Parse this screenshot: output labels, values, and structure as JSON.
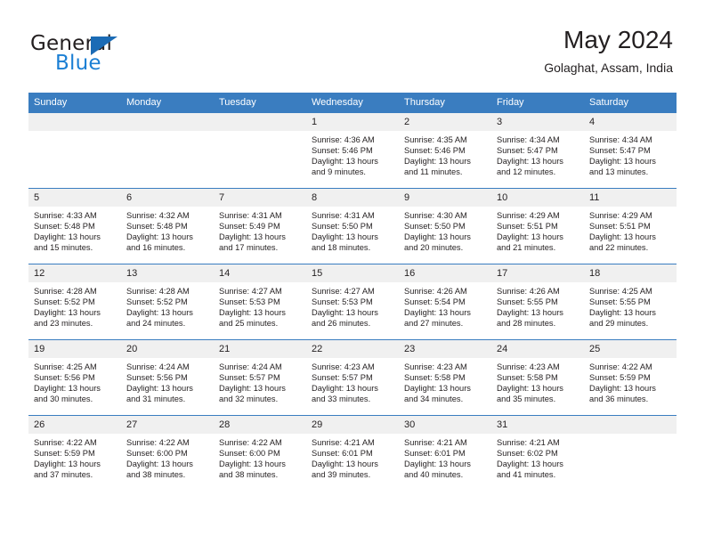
{
  "brand": {
    "name_top": "General",
    "name_bottom": "Blue",
    "accent_color": "#1b7fd4",
    "triangle_color": "#1b6bb5"
  },
  "header": {
    "title": "May 2024",
    "subtitle": "Golaghat, Assam, India"
  },
  "theme": {
    "header_row_bg": "#3a7dc0",
    "header_row_text": "#ffffff",
    "daynum_bg": "#f0f0f0",
    "body_text": "#231f20"
  },
  "weekday_headers": [
    "Sunday",
    "Monday",
    "Tuesday",
    "Wednesday",
    "Thursday",
    "Friday",
    "Saturday"
  ],
  "labels": {
    "sunrise_prefix": "Sunrise:",
    "sunset_prefix": "Sunset:",
    "daylight_prefix": "Daylight:"
  },
  "weeks": [
    [
      {
        "day": "",
        "empty": true
      },
      {
        "day": "",
        "empty": true
      },
      {
        "day": "",
        "empty": true
      },
      {
        "day": "1",
        "sunrise": "Sunrise: 4:36 AM",
        "sunset": "Sunset: 5:46 PM",
        "daylight": "Daylight: 13 hours and 9 minutes."
      },
      {
        "day": "2",
        "sunrise": "Sunrise: 4:35 AM",
        "sunset": "Sunset: 5:46 PM",
        "daylight": "Daylight: 13 hours and 11 minutes."
      },
      {
        "day": "3",
        "sunrise": "Sunrise: 4:34 AM",
        "sunset": "Sunset: 5:47 PM",
        "daylight": "Daylight: 13 hours and 12 minutes."
      },
      {
        "day": "4",
        "sunrise": "Sunrise: 4:34 AM",
        "sunset": "Sunset: 5:47 PM",
        "daylight": "Daylight: 13 hours and 13 minutes."
      }
    ],
    [
      {
        "day": "5",
        "sunrise": "Sunrise: 4:33 AM",
        "sunset": "Sunset: 5:48 PM",
        "daylight": "Daylight: 13 hours and 15 minutes."
      },
      {
        "day": "6",
        "sunrise": "Sunrise: 4:32 AM",
        "sunset": "Sunset: 5:48 PM",
        "daylight": "Daylight: 13 hours and 16 minutes."
      },
      {
        "day": "7",
        "sunrise": "Sunrise: 4:31 AM",
        "sunset": "Sunset: 5:49 PM",
        "daylight": "Daylight: 13 hours and 17 minutes."
      },
      {
        "day": "8",
        "sunrise": "Sunrise: 4:31 AM",
        "sunset": "Sunset: 5:50 PM",
        "daylight": "Daylight: 13 hours and 18 minutes."
      },
      {
        "day": "9",
        "sunrise": "Sunrise: 4:30 AM",
        "sunset": "Sunset: 5:50 PM",
        "daylight": "Daylight: 13 hours and 20 minutes."
      },
      {
        "day": "10",
        "sunrise": "Sunrise: 4:29 AM",
        "sunset": "Sunset: 5:51 PM",
        "daylight": "Daylight: 13 hours and 21 minutes."
      },
      {
        "day": "11",
        "sunrise": "Sunrise: 4:29 AM",
        "sunset": "Sunset: 5:51 PM",
        "daylight": "Daylight: 13 hours and 22 minutes."
      }
    ],
    [
      {
        "day": "12",
        "sunrise": "Sunrise: 4:28 AM",
        "sunset": "Sunset: 5:52 PM",
        "daylight": "Daylight: 13 hours and 23 minutes."
      },
      {
        "day": "13",
        "sunrise": "Sunrise: 4:28 AM",
        "sunset": "Sunset: 5:52 PM",
        "daylight": "Daylight: 13 hours and 24 minutes."
      },
      {
        "day": "14",
        "sunrise": "Sunrise: 4:27 AM",
        "sunset": "Sunset: 5:53 PM",
        "daylight": "Daylight: 13 hours and 25 minutes."
      },
      {
        "day": "15",
        "sunrise": "Sunrise: 4:27 AM",
        "sunset": "Sunset: 5:53 PM",
        "daylight": "Daylight: 13 hours and 26 minutes."
      },
      {
        "day": "16",
        "sunrise": "Sunrise: 4:26 AM",
        "sunset": "Sunset: 5:54 PM",
        "daylight": "Daylight: 13 hours and 27 minutes."
      },
      {
        "day": "17",
        "sunrise": "Sunrise: 4:26 AM",
        "sunset": "Sunset: 5:55 PM",
        "daylight": "Daylight: 13 hours and 28 minutes."
      },
      {
        "day": "18",
        "sunrise": "Sunrise: 4:25 AM",
        "sunset": "Sunset: 5:55 PM",
        "daylight": "Daylight: 13 hours and 29 minutes."
      }
    ],
    [
      {
        "day": "19",
        "sunrise": "Sunrise: 4:25 AM",
        "sunset": "Sunset: 5:56 PM",
        "daylight": "Daylight: 13 hours and 30 minutes."
      },
      {
        "day": "20",
        "sunrise": "Sunrise: 4:24 AM",
        "sunset": "Sunset: 5:56 PM",
        "daylight": "Daylight: 13 hours and 31 minutes."
      },
      {
        "day": "21",
        "sunrise": "Sunrise: 4:24 AM",
        "sunset": "Sunset: 5:57 PM",
        "daylight": "Daylight: 13 hours and 32 minutes."
      },
      {
        "day": "22",
        "sunrise": "Sunrise: 4:23 AM",
        "sunset": "Sunset: 5:57 PM",
        "daylight": "Daylight: 13 hours and 33 minutes."
      },
      {
        "day": "23",
        "sunrise": "Sunrise: 4:23 AM",
        "sunset": "Sunset: 5:58 PM",
        "daylight": "Daylight: 13 hours and 34 minutes."
      },
      {
        "day": "24",
        "sunrise": "Sunrise: 4:23 AM",
        "sunset": "Sunset: 5:58 PM",
        "daylight": "Daylight: 13 hours and 35 minutes."
      },
      {
        "day": "25",
        "sunrise": "Sunrise: 4:22 AM",
        "sunset": "Sunset: 5:59 PM",
        "daylight": "Daylight: 13 hours and 36 minutes."
      }
    ],
    [
      {
        "day": "26",
        "sunrise": "Sunrise: 4:22 AM",
        "sunset": "Sunset: 5:59 PM",
        "daylight": "Daylight: 13 hours and 37 minutes."
      },
      {
        "day": "27",
        "sunrise": "Sunrise: 4:22 AM",
        "sunset": "Sunset: 6:00 PM",
        "daylight": "Daylight: 13 hours and 38 minutes."
      },
      {
        "day": "28",
        "sunrise": "Sunrise: 4:22 AM",
        "sunset": "Sunset: 6:00 PM",
        "daylight": "Daylight: 13 hours and 38 minutes."
      },
      {
        "day": "29",
        "sunrise": "Sunrise: 4:21 AM",
        "sunset": "Sunset: 6:01 PM",
        "daylight": "Daylight: 13 hours and 39 minutes."
      },
      {
        "day": "30",
        "sunrise": "Sunrise: 4:21 AM",
        "sunset": "Sunset: 6:01 PM",
        "daylight": "Daylight: 13 hours and 40 minutes."
      },
      {
        "day": "31",
        "sunrise": "Sunrise: 4:21 AM",
        "sunset": "Sunset: 6:02 PM",
        "daylight": "Daylight: 13 hours and 41 minutes."
      },
      {
        "day": "",
        "empty": true
      }
    ]
  ]
}
